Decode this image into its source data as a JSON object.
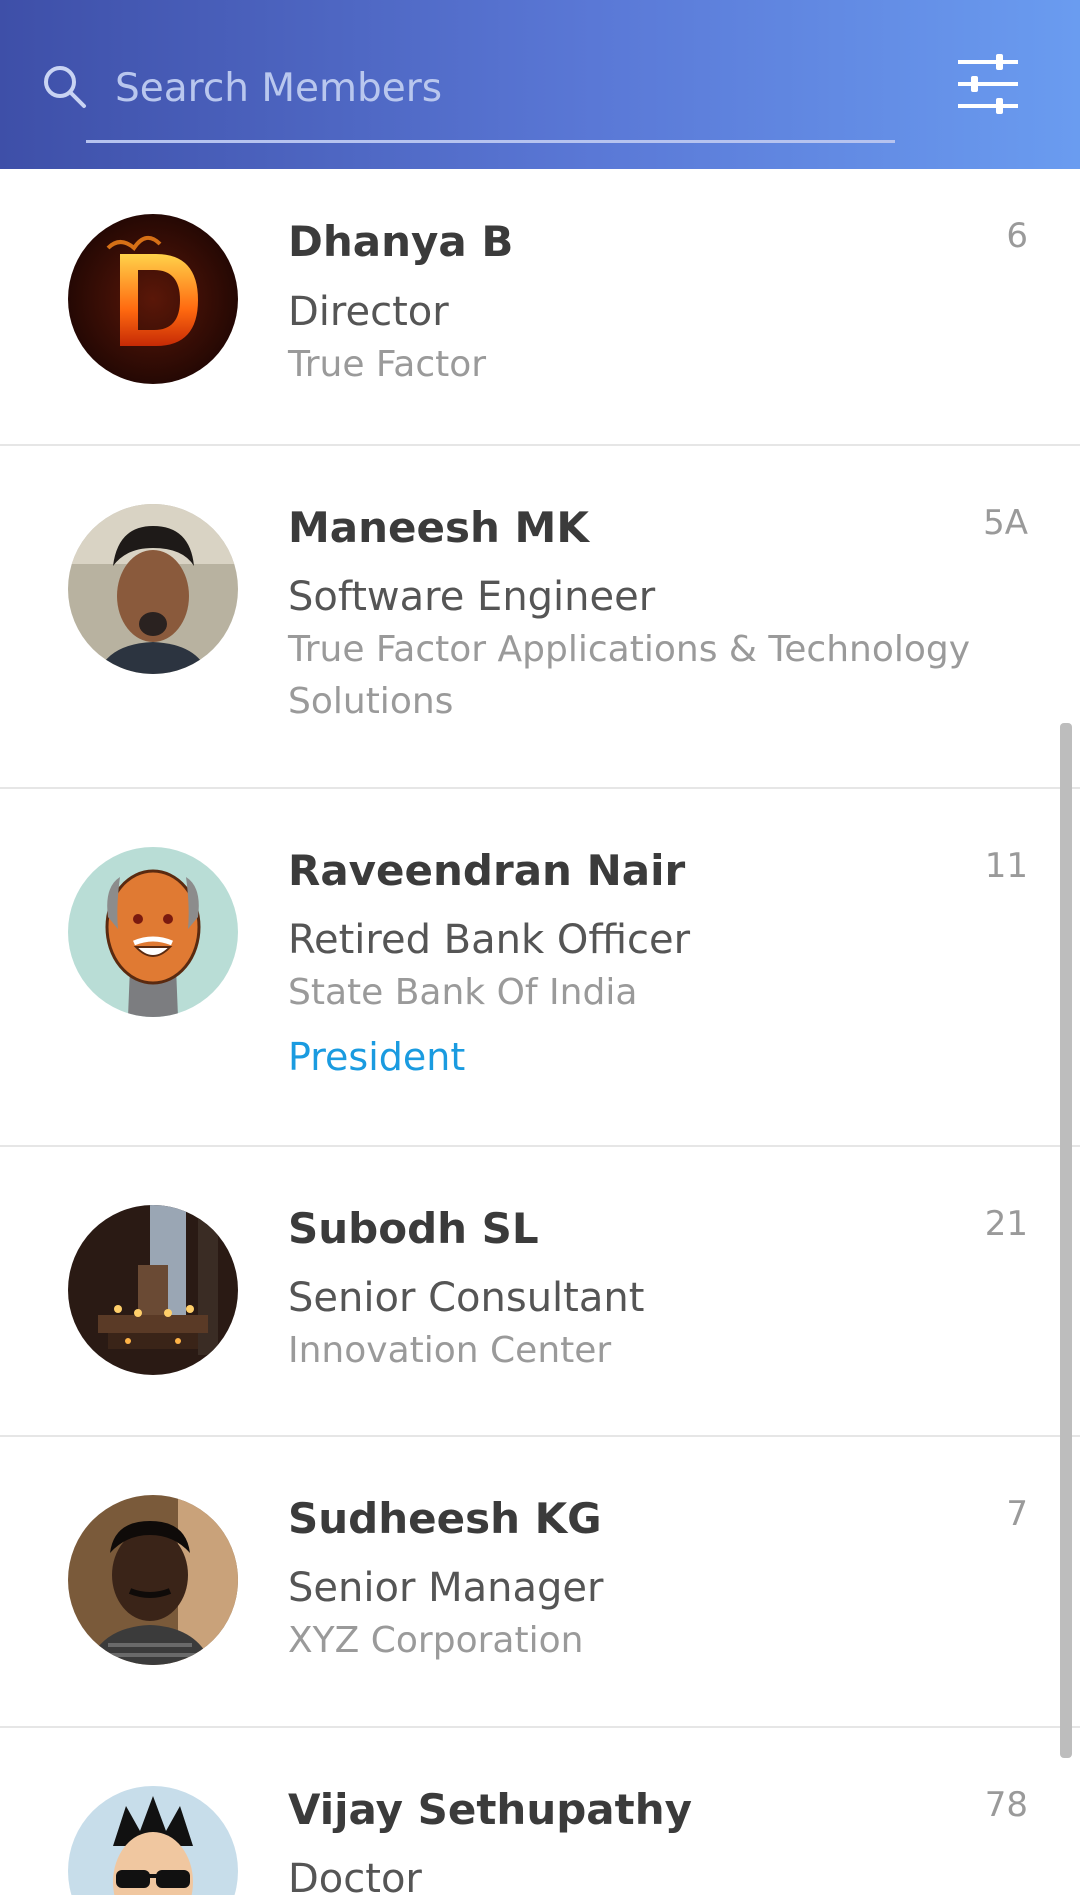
{
  "search": {
    "placeholder": "Search Members"
  },
  "members": [
    {
      "name": "Dhanya B",
      "title": "Director",
      "organization": "True Factor",
      "role": "",
      "count": "6",
      "avatar": "fire-letter-d"
    },
    {
      "name": "Maneesh MK",
      "title": "Software Engineer",
      "organization": "True Factor Applications & Technology Solutions",
      "role": "",
      "count": "5A",
      "avatar": "photo"
    },
    {
      "name": "Raveendran Nair",
      "title": "Retired Bank Officer",
      "organization": "State Bank Of India",
      "role": "President",
      "count": "11",
      "avatar": "cartoon-elder"
    },
    {
      "name": "Subodh SL",
      "title": "Senior Consultant",
      "organization": "Innovation Center",
      "role": "",
      "count": "21",
      "avatar": "photo-dark"
    },
    {
      "name": "Sudheesh KG",
      "title": "Senior Manager",
      "organization": "XYZ Corporation",
      "role": "",
      "count": "7",
      "avatar": "photo"
    },
    {
      "name": "Vijay Sethupathy",
      "title": "Doctor",
      "organization": "",
      "role": "",
      "count": "78",
      "avatar": "cartoon-sunglasses"
    }
  ],
  "colors": {
    "header_start": "#3e4fa8",
    "header_end": "#6a9cf0",
    "role_accent": "#1a9be0"
  },
  "icons": {
    "search": "search-icon",
    "filter": "sliders-icon"
  }
}
